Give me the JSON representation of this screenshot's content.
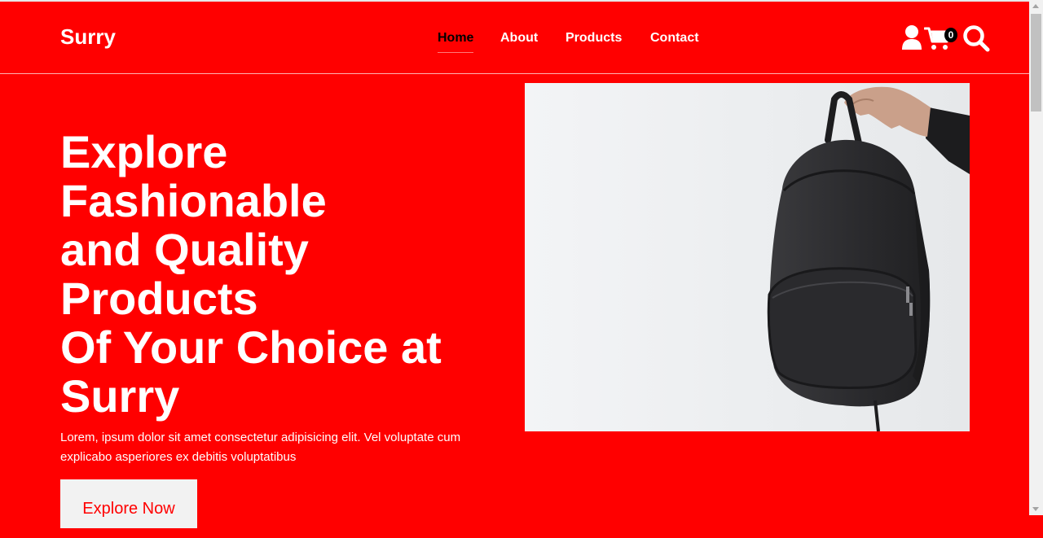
{
  "brand": {
    "name": "Surry"
  },
  "nav": {
    "links": [
      {
        "label": "Home",
        "active": true
      },
      {
        "label": "About",
        "active": false
      },
      {
        "label": "Products",
        "active": false
      },
      {
        "label": "Contact",
        "active": false
      }
    ]
  },
  "header_icons": {
    "user": "user-icon",
    "cart": "cart-icon",
    "cart_count": "0",
    "search": "search-icon"
  },
  "hero": {
    "title_lines": [
      "Explore",
      "Fashionable",
      "and Quality",
      "Products",
      "Of Your Choice at",
      "Surry"
    ],
    "description": "Lorem, ipsum dolor sit amet consectetur adipisicing elit. Vel voluptate cum explicabo asperiores ex debitis voluptatibus",
    "cta_label": "Explore Now"
  },
  "colors": {
    "brand_red": "#ff0000",
    "text_white": "#ffffff",
    "active_link": "#000000",
    "image_bg": "#eef0f2",
    "bag": "#2c2c2e"
  }
}
